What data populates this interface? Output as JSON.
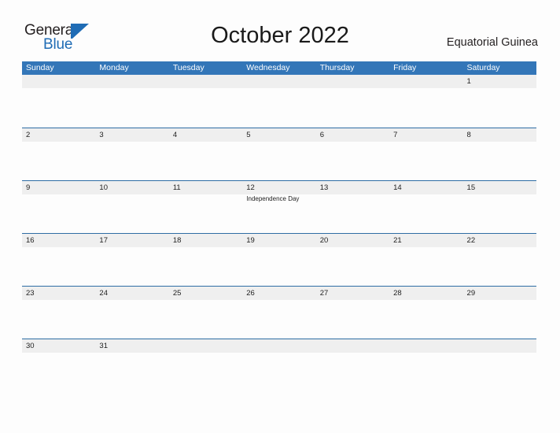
{
  "brand": {
    "logo_text_top": "General",
    "logo_text_bottom": "Blue",
    "logo_icon": "triangle-flag-icon",
    "color_primary": "#1f6cb5",
    "color_text": "#231f20"
  },
  "header": {
    "title": "October 2022",
    "country": "Equatorial Guinea"
  },
  "calendar": {
    "colors": {
      "header_bg": "#3376b8",
      "header_text": "#ffffff",
      "row_band": "#efefef",
      "row_line": "#2e6da4",
      "cell_bg": "#fdfdfd",
      "day_text": "#222222"
    },
    "day_names": [
      "Sunday",
      "Monday",
      "Tuesday",
      "Wednesday",
      "Thursday",
      "Friday",
      "Saturday"
    ],
    "weeks": [
      [
        {
          "day": ""
        },
        {
          "day": ""
        },
        {
          "day": ""
        },
        {
          "day": ""
        },
        {
          "day": ""
        },
        {
          "day": ""
        },
        {
          "day": "1",
          "events": []
        }
      ],
      [
        {
          "day": "2",
          "events": []
        },
        {
          "day": "3",
          "events": []
        },
        {
          "day": "4",
          "events": []
        },
        {
          "day": "5",
          "events": []
        },
        {
          "day": "6",
          "events": []
        },
        {
          "day": "7",
          "events": []
        },
        {
          "day": "8",
          "events": []
        }
      ],
      [
        {
          "day": "9",
          "events": []
        },
        {
          "day": "10",
          "events": []
        },
        {
          "day": "11",
          "events": []
        },
        {
          "day": "12",
          "events": [
            "Independence Day"
          ]
        },
        {
          "day": "13",
          "events": []
        },
        {
          "day": "14",
          "events": []
        },
        {
          "day": "15",
          "events": []
        }
      ],
      [
        {
          "day": "16",
          "events": []
        },
        {
          "day": "17",
          "events": []
        },
        {
          "day": "18",
          "events": []
        },
        {
          "day": "19",
          "events": []
        },
        {
          "day": "20",
          "events": []
        },
        {
          "day": "21",
          "events": []
        },
        {
          "day": "22",
          "events": []
        }
      ],
      [
        {
          "day": "23",
          "events": []
        },
        {
          "day": "24",
          "events": []
        },
        {
          "day": "25",
          "events": []
        },
        {
          "day": "26",
          "events": []
        },
        {
          "day": "27",
          "events": []
        },
        {
          "day": "28",
          "events": []
        },
        {
          "day": "29",
          "events": []
        }
      ],
      [
        {
          "day": "30",
          "events": []
        },
        {
          "day": "31",
          "events": []
        },
        {
          "day": ""
        },
        {
          "day": ""
        },
        {
          "day": ""
        },
        {
          "day": ""
        },
        {
          "day": ""
        }
      ]
    ]
  }
}
